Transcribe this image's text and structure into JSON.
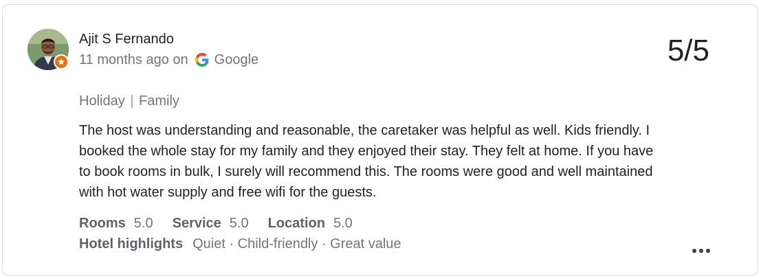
{
  "review": {
    "author": "Ajit S Fernando",
    "time_ago": "11 months ago on",
    "source": "Google",
    "score": "5/5",
    "trip_type": "Holiday",
    "companion": "Family",
    "separator": "|",
    "text": "The host was understanding and reasonable, the caretaker was helpful as well. Kids friendly. I booked the whole stay for my family and they enjoyed their stay. They felt at home. If you have to book rooms in bulk, I surely will recommend this. The rooms were good and well maintained with hot water supply and free wifi for the guests.",
    "ratings": [
      {
        "label": "Rooms",
        "value": "5.0"
      },
      {
        "label": "Service",
        "value": "5.0"
      },
      {
        "label": "Location",
        "value": "5.0"
      }
    ],
    "highlights_label": "Hotel highlights",
    "highlights": "Quiet · Child-friendly · Great value"
  },
  "icons": {
    "avatar": "user-photo",
    "badge": "local-guide-star-icon",
    "source_icon": "google-g-icon",
    "more": "more-horiz-icon"
  },
  "colors": {
    "badge": "#e8710a",
    "text_primary": "#202124",
    "text_secondary": "#70757a",
    "border": "#dadce0"
  }
}
